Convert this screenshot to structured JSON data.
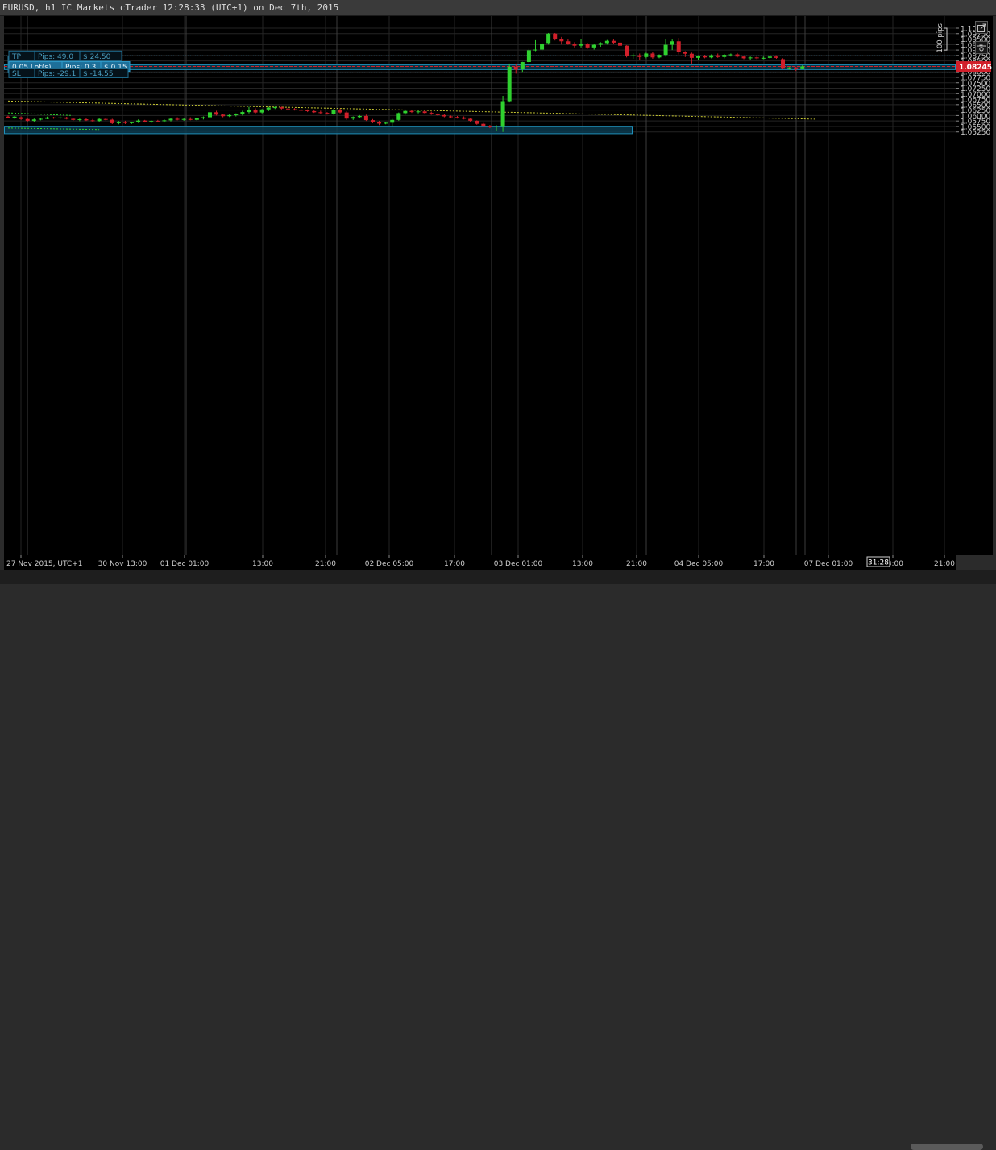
{
  "window_title": "EURUSD, h1 IC Markets cTrader 12:28:33 (UTC+1) on Dec 7th, 2015",
  "price_axis": {
    "ticks": [
      "1.10",
      "1.09750",
      "1.09500",
      "1.09250",
      "1.09000",
      "1.08750",
      "1.08500",
      "1.08250",
      "1.08000",
      "1.07750",
      "1.07500",
      "1.07250",
      "1.07000",
      "1.06750",
      "1.06500",
      "1.06250",
      "1.06000",
      "1.05750",
      "1.05500",
      "1.05250"
    ],
    "current_price": "1.08245",
    "ruler_label": "100 pips"
  },
  "time_axis": {
    "ticks": [
      "27 Nov 2015, UTC+1",
      "30 Nov 13:00",
      "01 Dec 01:00",
      "13:00",
      "21:00",
      "02 Dec 05:00",
      "17:00",
      "03 Dec 01:00",
      "13:00",
      "21:00",
      "04 Dec 05:00",
      "17:00",
      "07 Dec 01:00",
      "13:00",
      "21:00"
    ],
    "countdown": "31:28"
  },
  "trade": {
    "tp": {
      "tag": "TP",
      "pips": "Pips: 49.0",
      "money": "$ 24.50"
    },
    "position": {
      "lots": "0.05 Lot(s)",
      "pips": "Pips: 0.3",
      "money": "$ 0.15"
    },
    "sl": {
      "tag": "SL",
      "pips": "Pips: -29.1",
      "money": "$ -14.55"
    }
  },
  "colors": {
    "bull": "#2fd12f",
    "bear": "#d11f2a",
    "zone": "#1f8fb8",
    "trendline": "#c8c832",
    "price_line": "#d11f2a"
  },
  "icons": [
    "popout-icon",
    "camera-icon"
  ],
  "chart_data": {
    "type": "candlestick",
    "symbol": "EURUSD",
    "timeframe": "h1",
    "ylim": [
      1.0515,
      1.1012
    ],
    "y_scale": "linear",
    "grid": true,
    "candles": [
      [
        1.0595,
        1.06,
        1.0588,
        1.059
      ],
      [
        1.059,
        1.0598,
        1.0585,
        1.0595
      ],
      [
        1.0592,
        1.0596,
        1.058,
        1.0584
      ],
      [
        1.0584,
        1.059,
        1.0572,
        1.0576
      ],
      [
        1.0576,
        1.0586,
        1.057,
        1.0582
      ],
      [
        1.0582,
        1.0588,
        1.0578,
        1.0585
      ],
      [
        1.0585,
        1.0595,
        1.0583,
        1.0591
      ],
      [
        1.0591,
        1.0594,
        1.0585,
        1.0588
      ],
      [
        1.0588,
        1.0596,
        1.0584,
        1.0591
      ],
      [
        1.0591,
        1.0594,
        1.0582,
        1.0585
      ],
      [
        1.0585,
        1.059,
        1.0576,
        1.058
      ],
      [
        1.058,
        1.0586,
        1.0574,
        1.0583
      ],
      [
        1.0583,
        1.0588,
        1.0575,
        1.0578
      ],
      [
        1.0578,
        1.0584,
        1.057,
        1.0575
      ],
      [
        1.0575,
        1.0588,
        1.0572,
        1.0584
      ],
      [
        1.0584,
        1.059,
        1.0578,
        1.0581
      ],
      [
        1.0581,
        1.0585,
        1.0561,
        1.0565
      ],
      [
        1.0565,
        1.0575,
        1.056,
        1.057
      ],
      [
        1.057,
        1.0576,
        1.0561,
        1.0566
      ],
      [
        1.0566,
        1.0572,
        1.0562,
        1.0569
      ],
      [
        1.0569,
        1.0582,
        1.0566,
        1.0577
      ],
      [
        1.0577,
        1.058,
        1.0568,
        1.0572
      ],
      [
        1.0572,
        1.0578,
        1.0566,
        1.0575
      ],
      [
        1.0575,
        1.058,
        1.0571,
        1.0574
      ],
      [
        1.0574,
        1.0582,
        1.0568,
        1.0578
      ],
      [
        1.0578,
        1.059,
        1.0573,
        1.0585
      ],
      [
        1.0585,
        1.0592,
        1.0578,
        1.0581
      ],
      [
        1.0581,
        1.0588,
        1.0576,
        1.0584
      ],
      [
        1.0584,
        1.0592,
        1.0578,
        1.058
      ],
      [
        1.058,
        1.059,
        1.0576,
        1.0588
      ],
      [
        1.0588,
        1.0596,
        1.0582,
        1.0592
      ],
      [
        1.0592,
        1.062,
        1.0588,
        1.0615
      ],
      [
        1.0615,
        1.0622,
        1.06,
        1.0604
      ],
      [
        1.0604,
        1.0608,
        1.0592,
        1.0597
      ],
      [
        1.0597,
        1.0606,
        1.0593,
        1.0602
      ],
      [
        1.0602,
        1.061,
        1.0596,
        1.0605
      ],
      [
        1.0605,
        1.0622,
        1.06,
        1.0616
      ],
      [
        1.0616,
        1.064,
        1.061,
        1.0625
      ],
      [
        1.0625,
        1.0633,
        1.061,
        1.0614
      ],
      [
        1.0614,
        1.063,
        1.061,
        1.0628
      ],
      [
        1.0628,
        1.064,
        1.062,
        1.0636
      ],
      [
        1.0636,
        1.0642,
        1.063,
        1.0638
      ],
      [
        1.0638,
        1.0641,
        1.0628,
        1.0632
      ],
      [
        1.0632,
        1.0636,
        1.0624,
        1.0629
      ],
      [
        1.0629,
        1.0634,
        1.0623,
        1.0626
      ],
      [
        1.0626,
        1.063,
        1.062,
        1.0624
      ],
      [
        1.0624,
        1.0628,
        1.0616,
        1.062
      ],
      [
        1.062,
        1.0624,
        1.0612,
        1.0615
      ],
      [
        1.0615,
        1.0622,
        1.0608,
        1.0612
      ],
      [
        1.0612,
        1.0616,
        1.0604,
        1.0608
      ],
      [
        1.0608,
        1.063,
        1.0604,
        1.0626
      ],
      [
        1.0626,
        1.0632,
        1.061,
        1.0614
      ],
      [
        1.0614,
        1.062,
        1.058,
        1.0586
      ],
      [
        1.0586,
        1.0596,
        1.058,
        1.0593
      ],
      [
        1.0593,
        1.0602,
        1.0588,
        1.0598
      ],
      [
        1.0598,
        1.0604,
        1.0575,
        1.0579
      ],
      [
        1.0579,
        1.0584,
        1.0565,
        1.0571
      ],
      [
        1.0571,
        1.0576,
        1.0556,
        1.0563
      ],
      [
        1.0563,
        1.0568,
        1.056,
        1.0567
      ],
      [
        1.0567,
        1.0585,
        1.0552,
        1.058
      ],
      [
        1.058,
        1.0614,
        1.0576,
        1.0611
      ],
      [
        1.0611,
        1.0626,
        1.0604,
        1.0621
      ],
      [
        1.0621,
        1.0624,
        1.0612,
        1.0616
      ],
      [
        1.0616,
        1.0622,
        1.061,
        1.0619
      ],
      [
        1.0619,
        1.0623,
        1.0608,
        1.0612
      ],
      [
        1.0612,
        1.0618,
        1.0603,
        1.0606
      ],
      [
        1.0606,
        1.061,
        1.0598,
        1.0602
      ],
      [
        1.0602,
        1.0606,
        1.0592,
        1.0596
      ],
      [
        1.0596,
        1.06,
        1.059,
        1.0593
      ],
      [
        1.0593,
        1.0598,
        1.0586,
        1.0591
      ],
      [
        1.0591,
        1.0596,
        1.0582,
        1.0585
      ],
      [
        1.0585,
        1.059,
        1.0572,
        1.0576
      ],
      [
        1.0576,
        1.0578,
        1.0558,
        1.0562
      ],
      [
        1.0562,
        1.0566,
        1.0548,
        1.0553
      ],
      [
        1.0553,
        1.0557,
        1.0542,
        1.0547
      ],
      [
        1.0547,
        1.0556,
        1.053,
        1.055
      ],
      [
        1.0552,
        1.069,
        1.0525,
        1.0666
      ],
      [
        1.0666,
        1.0838,
        1.066,
        1.0823
      ],
      [
        1.0823,
        1.0838,
        1.0792,
        1.081
      ],
      [
        1.0812,
        1.0846,
        1.08,
        1.0845
      ],
      [
        1.0845,
        1.0905,
        1.084,
        1.0899
      ],
      [
        1.0899,
        1.0945,
        1.0895,
        1.0902
      ],
      [
        1.0902,
        1.0935,
        1.0895,
        1.093
      ],
      [
        1.0932,
        1.0978,
        1.0925,
        1.0975
      ],
      [
        1.0975,
        1.0978,
        1.0944,
        1.0952
      ],
      [
        1.0952,
        1.096,
        1.0925,
        1.094
      ],
      [
        1.094,
        1.0948,
        1.0924,
        1.0928
      ],
      [
        1.0928,
        1.0936,
        1.0912,
        1.092
      ],
      [
        1.092,
        1.095,
        1.0912,
        1.0928
      ],
      [
        1.0928,
        1.0932,
        1.0906,
        1.0912
      ],
      [
        1.0912,
        1.093,
        1.0902,
        1.0924
      ],
      [
        1.0924,
        1.0936,
        1.0915,
        1.0932
      ],
      [
        1.0932,
        1.0946,
        1.0925,
        1.0942
      ],
      [
        1.0942,
        1.0948,
        1.0928,
        1.0934
      ],
      [
        1.0934,
        1.0946,
        1.0918,
        1.092
      ],
      [
        1.092,
        1.0922,
        1.0866,
        1.0872
      ],
      [
        1.0872,
        1.0885,
        1.086,
        1.0876
      ],
      [
        1.0876,
        1.0884,
        1.0856,
        1.0868
      ],
      [
        1.0868,
        1.0888,
        1.0862,
        1.0884
      ],
      [
        1.0884,
        1.089,
        1.086,
        1.0866
      ],
      [
        1.0866,
        1.088,
        1.0862,
        1.0878
      ],
      [
        1.0878,
        1.0952,
        1.087,
        1.0924
      ],
      [
        1.0924,
        1.0948,
        1.09,
        1.094
      ],
      [
        1.094,
        1.0955,
        1.088,
        1.089
      ],
      [
        1.089,
        1.0895,
        1.0868,
        1.0883
      ],
      [
        1.0883,
        1.0888,
        1.0838,
        1.0864
      ],
      [
        1.0864,
        1.0876,
        1.0854,
        1.0872
      ],
      [
        1.0872,
        1.0878,
        1.0862,
        1.0866
      ],
      [
        1.0866,
        1.088,
        1.0862,
        1.0876
      ],
      [
        1.0876,
        1.0884,
        1.0864,
        1.0868
      ],
      [
        1.0868,
        1.0882,
        1.0862,
        1.0878
      ],
      [
        1.0878,
        1.0884,
        1.087,
        1.088
      ],
      [
        1.088,
        1.0886,
        1.0866,
        1.087
      ],
      [
        1.087,
        1.0874,
        1.0858,
        1.0862
      ],
      [
        1.0862,
        1.087,
        1.0855,
        1.0866
      ],
      [
        1.0866,
        1.087,
        1.0858,
        1.0862
      ],
      [
        1.0862,
        1.087,
        1.0858,
        1.0864
      ],
      [
        1.0864,
        1.0874,
        1.086,
        1.087
      ],
      [
        1.087,
        1.0876,
        1.086,
        1.0864
      ],
      [
        1.0858,
        1.0862,
        1.0812,
        1.0818
      ],
      [
        1.0818,
        1.0822,
        1.081,
        1.082
      ],
      [
        1.082,
        1.0824,
        1.0804,
        1.0816
      ],
      [
        1.0816,
        1.083,
        1.0812,
        1.0825
      ]
    ],
    "trendlines": [
      {
        "color": "#c8c832",
        "from": [
          0,
          1.06665
        ],
        "to": [
          124,
          1.05835
        ]
      },
      {
        "color": "#2fd12f",
        "from": [
          0,
          1.0612
        ],
        "to": [
          10,
          1.06
        ]
      },
      {
        "color": "#2fd12f",
        "from": [
          0,
          1.0543
        ],
        "to": [
          14,
          1.0536
        ]
      }
    ],
    "zones": [
      {
        "top": 1.08325,
        "bottom": 1.08105,
        "color": "#1f8fb8"
      },
      {
        "top": 1.0551,
        "bottom": 1.0517,
        "color": "#1f8fb8"
      }
    ],
    "levels": {
      "tp": 1.08735,
      "entry": 1.08245,
      "sl": 1.07955
    }
  }
}
